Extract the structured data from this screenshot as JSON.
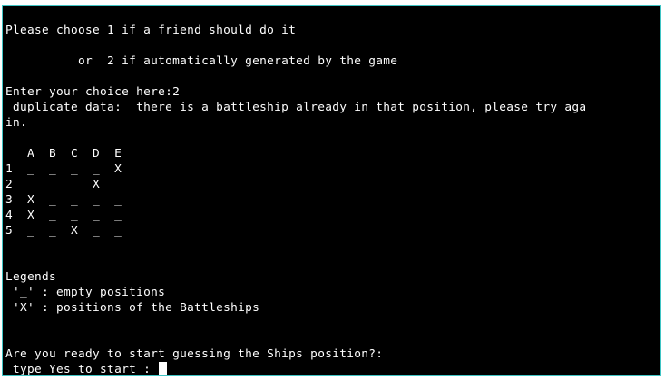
{
  "terminal": {
    "lines": [
      "Please choose 1 if a friend should do it",
      "",
      "          or  2 if automatically generated by the game",
      "",
      "Enter your choice here:2",
      " duplicate data:  there is a battleship already in that position, please try aga",
      "in.",
      "",
      "   A  B  C  D  E",
      "1  _  _  _  _  X",
      "2  _  _  _  X  _",
      "3  X  _  _  _  _",
      "4  X  _  _  _  _",
      "5  _  _  X  _  _",
      "",
      "",
      "",
      "Legends",
      " '_' : empty positions",
      " 'X' : positions of the Battleships",
      "",
      "",
      "Are you ready to start guessing the Ships position?:",
      " type Yes to start : "
    ]
  },
  "input": {
    "value": ""
  },
  "colors": {
    "background": "#000000",
    "foreground": "#ffffff",
    "border": "#3fc4c4"
  }
}
